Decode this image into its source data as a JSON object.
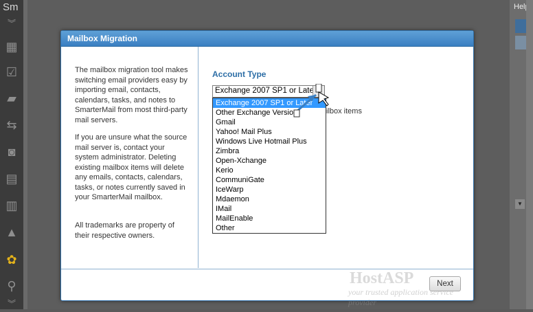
{
  "app": {
    "title": "Sm",
    "help_label": "Help"
  },
  "sidebar": {
    "icons": [
      "chevrons-down-icon",
      "calendar-icon",
      "checkbox-icon",
      "note-icon",
      "arrows-icon",
      "rss-icon",
      "folders-icon",
      "bar-chart-icon",
      "warning-icon",
      "gears-icon",
      "search-icon",
      "chevrons-down-icon"
    ]
  },
  "modal": {
    "title": "Mailbox Migration",
    "info": [
      "The mailbox migration tool makes switching email providers easy by importing email, contacts, calendars, tasks, and notes to SmarterMail from most third-party mail servers.",
      "If you are unsure what the source mail server is, contact your system administrator. Deleting existing mailbox items will delete any emails, contacts, calendars, tasks, or notes currently saved in your SmarterMail mailbox.",
      "All trademarks are property of their respective owners."
    ],
    "account_type_label": "Account Type",
    "selected_value": "Exchange 2007 SP1 or Later",
    "partial_label": "ilbox items",
    "options": [
      "Exchange 2007 SP1 or Later",
      "Other Exchange Version",
      "Gmail",
      "Yahoo! Mail Plus",
      "Windows Live Hotmail Plus",
      "Zimbra",
      "Open-Xchange",
      "Kerio",
      "CommuniGate",
      "IceWarp",
      "Mdaemon",
      "IMail",
      "MailEnable",
      "Other"
    ],
    "next_label": "Next",
    "watermark_title": "HostASP",
    "watermark_subtitle": "your trusted application service provider"
  },
  "colors": {
    "accent": "#3a7fc2",
    "selection": "#3399ff",
    "label": "#2d6ea6"
  }
}
